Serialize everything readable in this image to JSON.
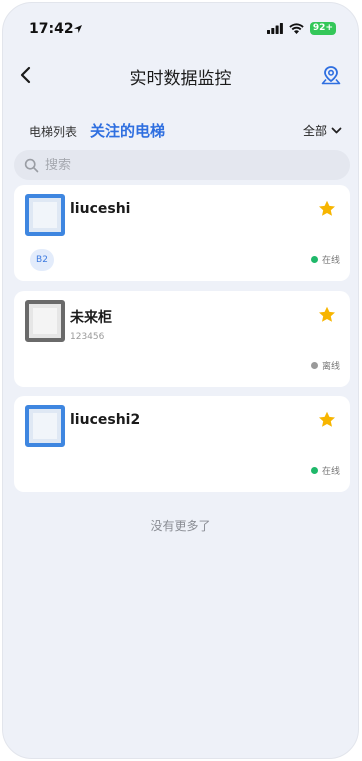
{
  "status_bar": {
    "time": "17:42",
    "battery": "92+"
  },
  "nav": {
    "title": "实时数据监控"
  },
  "tabs": {
    "list_label": "电梯列表",
    "followed_label": "关注的电梯"
  },
  "filter": {
    "label": "全部"
  },
  "search": {
    "placeholder": "搜索"
  },
  "elevators": [
    {
      "name": "liuceshi",
      "code": "",
      "floor": "B2",
      "status": "在线",
      "status_color": "#1fb86a",
      "starred": true
    },
    {
      "name": "未来柜",
      "code": "123456",
      "floor": "",
      "status": "离线",
      "status_color": "#9a9a9a",
      "starred": true
    },
    {
      "name": "liuceshi2",
      "code": "",
      "floor": "",
      "status": "在线",
      "status_color": "#1fb86a",
      "starred": true
    }
  ],
  "footer": {
    "no_more": "没有更多了"
  },
  "colors": {
    "accent": "#2f6fe0",
    "star": "#f7b500",
    "online": "#1fb86a",
    "offline": "#9a9a9a"
  },
  "icons": [
    "location-arrow-icon",
    "signal-icon",
    "wifi-icon",
    "battery-icon",
    "back-chevron-icon",
    "map-pin-icon",
    "chevron-down-icon",
    "search-icon",
    "star-icon",
    "elevator-icon"
  ]
}
